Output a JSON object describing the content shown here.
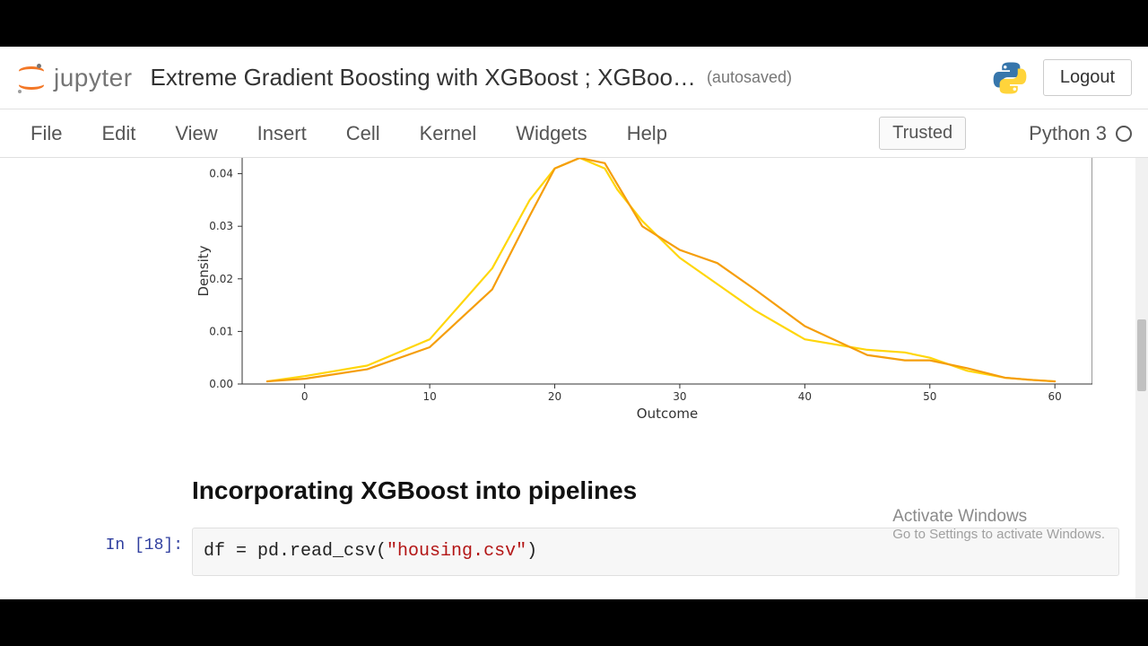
{
  "header": {
    "brand_word": "jupyter",
    "title": "Extreme Gradient Boosting with XGBoost ; XGBoo…",
    "autosave": "(autosaved)",
    "logout": "Logout"
  },
  "menu": {
    "items": [
      "File",
      "Edit",
      "View",
      "Insert",
      "Cell",
      "Kernel",
      "Widgets",
      "Help"
    ],
    "trusted": "Trusted",
    "kernel_name": "Python 3"
  },
  "heading": "Incorporating XGBoost into pipelines",
  "code_cell": {
    "prompt": "In [18]:",
    "line_pre": "df = pd.read_csv(",
    "line_str": "\"housing.csv\"",
    "line_post": ")"
  },
  "watermark": {
    "title": "Activate Windows",
    "sub": "Go to Settings to activate Windows."
  },
  "chart_data": {
    "type": "line",
    "title": "",
    "xlabel": "Outcome",
    "ylabel": "Density",
    "xlim": [
      -5,
      63
    ],
    "ylim": [
      0.0,
      0.043
    ],
    "x_ticks": [
      0,
      10,
      20,
      30,
      40,
      50,
      60
    ],
    "y_ticks": [
      0.0,
      0.01,
      0.02,
      0.03,
      0.04
    ],
    "series": [
      {
        "name": "yellow",
        "color": "#ffd60a",
        "x": [
          -3,
          0,
          5,
          10,
          15,
          18,
          20,
          22,
          24,
          25,
          27,
          30,
          33,
          36,
          40,
          45,
          48,
          50,
          53,
          56,
          58,
          60
        ],
        "values": [
          0.0005,
          0.0015,
          0.0035,
          0.0085,
          0.022,
          0.035,
          0.041,
          0.043,
          0.041,
          0.037,
          0.031,
          0.024,
          0.019,
          0.014,
          0.0085,
          0.0065,
          0.006,
          0.005,
          0.0025,
          0.0012,
          0.0008,
          0.0005
        ]
      },
      {
        "name": "orange",
        "color": "#f59e0b",
        "x": [
          -3,
          0,
          5,
          10,
          15,
          18,
          20,
          22,
          24,
          25,
          27,
          30,
          33,
          36,
          40,
          45,
          48,
          50,
          53,
          56,
          58,
          60
        ],
        "values": [
          0.0005,
          0.001,
          0.0028,
          0.007,
          0.018,
          0.032,
          0.041,
          0.045,
          0.042,
          0.038,
          0.03,
          0.0255,
          0.023,
          0.018,
          0.011,
          0.0055,
          0.0045,
          0.0045,
          0.003,
          0.0012,
          0.0008,
          0.0005
        ]
      }
    ]
  }
}
